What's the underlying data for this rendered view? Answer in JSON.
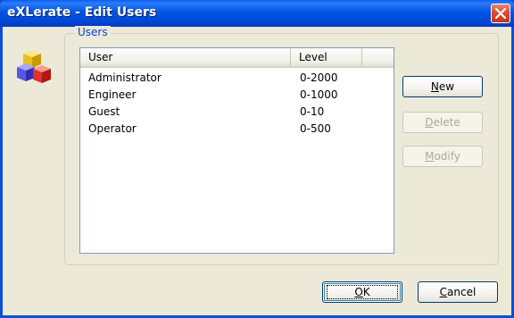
{
  "window": {
    "title": "eXLerate - Edit Users"
  },
  "group": {
    "label": "Users"
  },
  "list": {
    "columns": [
      "User",
      "Level"
    ],
    "rows": [
      {
        "user": "Administrator",
        "level": "0-2000"
      },
      {
        "user": "Engineer",
        "level": "0-1000"
      },
      {
        "user": "Guest",
        "level": "0-10"
      },
      {
        "user": "Operator",
        "level": "0-500"
      }
    ]
  },
  "buttons": {
    "new": {
      "first": "N",
      "rest": "ew"
    },
    "delete": {
      "first": "D",
      "rest": "elete"
    },
    "modify": {
      "first": "M",
      "rest": "odify"
    },
    "ok": {
      "first": "O",
      "rest": "K"
    },
    "cancel": {
      "first": "C",
      "rest": "ancel"
    }
  },
  "icons": {
    "close": "close-icon",
    "app": "cubes-app-icon"
  },
  "colors": {
    "title_bar": "#0054e3",
    "close_button": "#d9492c",
    "group_label": "#0046d5",
    "dialog_bg": "#ece9d8"
  }
}
